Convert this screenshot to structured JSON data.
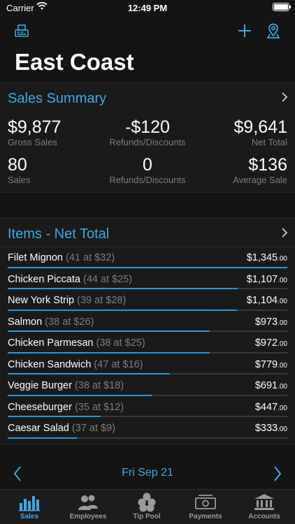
{
  "status": {
    "carrier": "Carrier",
    "time": "12:49 PM"
  },
  "header": {
    "title": "East Coast",
    "icons": [
      "register-icon",
      "plus-icon",
      "location-pin-icon"
    ]
  },
  "sales_summary": {
    "title": "Sales Summary",
    "stats": [
      {
        "value": "$9,877",
        "label": "Gross Sales"
      },
      {
        "value": "-$120",
        "label": "Refunds/Discounts"
      },
      {
        "value": "$9,641",
        "label": "Net Total"
      },
      {
        "value": "80",
        "label": "Sales"
      },
      {
        "value": "0",
        "label": "Refunds/Discounts"
      },
      {
        "value": "$136",
        "label": "Average Sale"
      }
    ]
  },
  "items": {
    "title": "Items - Net Total",
    "rows": [
      {
        "name": "Filet Mignon",
        "qty": "(41 at $32)",
        "amount": "$1,345",
        "cents": ".00",
        "share": 1.0
      },
      {
        "name": "Chicken Piccata",
        "qty": "(44 at $25)",
        "amount": "$1,107",
        "cents": ".00",
        "share": 0.823
      },
      {
        "name": "New York Strip",
        "qty": "(39 at $28)",
        "amount": "$1,104",
        "cents": ".00",
        "share": 0.821
      },
      {
        "name": "Salmon",
        "qty": "(38 at $26)",
        "amount": "$973",
        "cents": ".00",
        "share": 0.723
      },
      {
        "name": "Chicken Parmesan",
        "qty": "(38 at $25)",
        "amount": "$972",
        "cents": ".00",
        "share": 0.723
      },
      {
        "name": "Chicken Sandwich",
        "qty": "(47 at $16)",
        "amount": "$779",
        "cents": ".00",
        "share": 0.579
      },
      {
        "name": "Veggie Burger",
        "qty": "(38 at $18)",
        "amount": "$691",
        "cents": ".00",
        "share": 0.514
      },
      {
        "name": "Cheeseburger",
        "qty": "(35 at $12)",
        "amount": "$447",
        "cents": ".00",
        "share": 0.332
      },
      {
        "name": "Caesar Salad",
        "qty": "(37 at $9)",
        "amount": "$333",
        "cents": ".00",
        "share": 0.248
      }
    ]
  },
  "date_nav": {
    "date": "Fri Sep 21"
  },
  "tabs": [
    {
      "label": "Sales",
      "icon": "bar-chart-icon",
      "active": true
    },
    {
      "label": "Employees",
      "icon": "people-icon",
      "active": false
    },
    {
      "label": "Tip Pool",
      "icon": "coins-icon",
      "active": false
    },
    {
      "label": "Payments",
      "icon": "banknote-icon",
      "active": false
    },
    {
      "label": "Accounts",
      "icon": "bank-icon",
      "active": false
    }
  ],
  "colors": {
    "accent": "#3ea8e6",
    "bar": "#2b96d8",
    "background": "#141414",
    "panel": "#1a1a1a"
  }
}
